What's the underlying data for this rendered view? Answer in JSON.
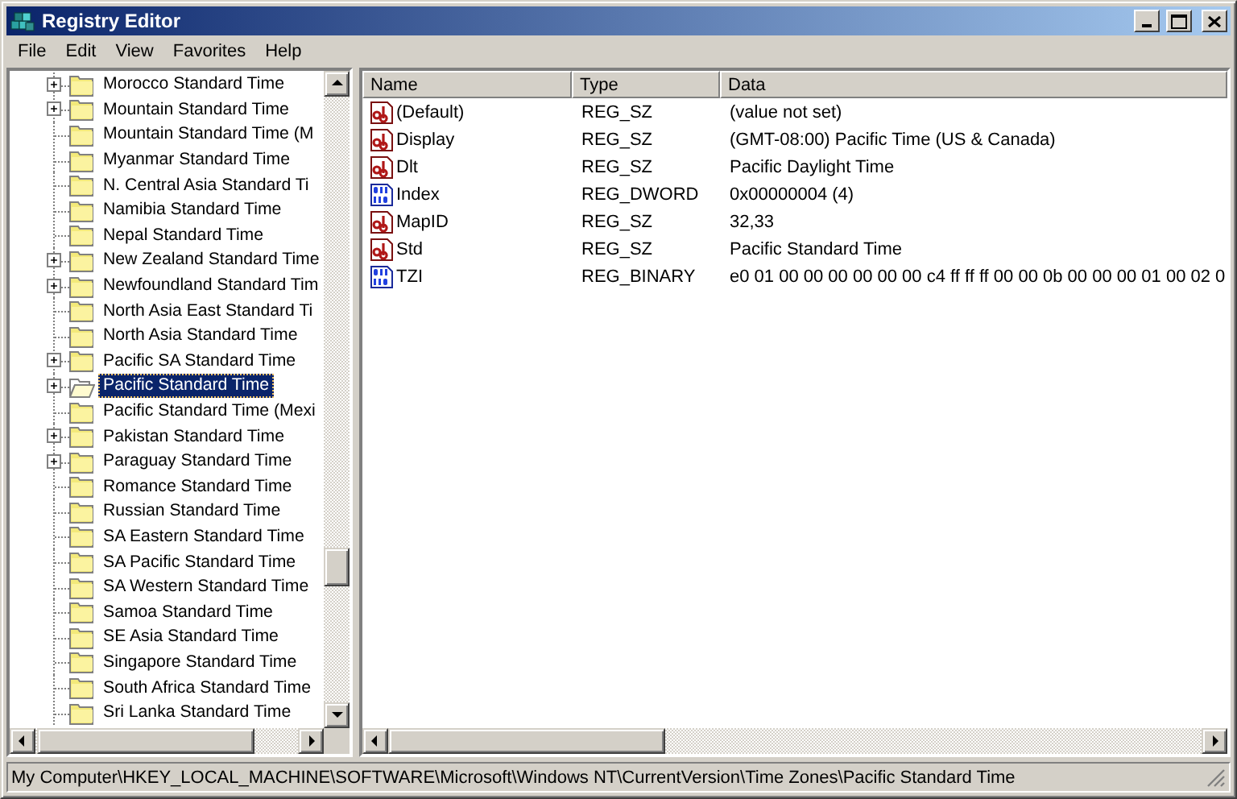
{
  "window": {
    "title": "Registry Editor"
  },
  "menu": [
    "File",
    "Edit",
    "View",
    "Favorites",
    "Help"
  ],
  "tree": {
    "items": [
      {
        "label": "Morocco Standard Time",
        "expandable": true,
        "selected": false
      },
      {
        "label": "Mountain Standard Time",
        "expandable": true,
        "selected": false
      },
      {
        "label": "Mountain Standard Time (M",
        "expandable": false,
        "selected": false
      },
      {
        "label": "Myanmar Standard Time",
        "expandable": false,
        "selected": false
      },
      {
        "label": "N. Central Asia Standard Ti",
        "expandable": false,
        "selected": false
      },
      {
        "label": "Namibia Standard Time",
        "expandable": false,
        "selected": false
      },
      {
        "label": "Nepal Standard Time",
        "expandable": false,
        "selected": false
      },
      {
        "label": "New Zealand Standard Time",
        "expandable": true,
        "selected": false
      },
      {
        "label": "Newfoundland Standard Tim",
        "expandable": true,
        "selected": false
      },
      {
        "label": "North Asia East Standard Ti",
        "expandable": false,
        "selected": false
      },
      {
        "label": "North Asia Standard Time",
        "expandable": false,
        "selected": false
      },
      {
        "label": "Pacific SA Standard Time",
        "expandable": true,
        "selected": false
      },
      {
        "label": "Pacific Standard Time",
        "expandable": true,
        "selected": true
      },
      {
        "label": "Pacific Standard Time (Mexi",
        "expandable": false,
        "selected": false
      },
      {
        "label": "Pakistan Standard Time",
        "expandable": true,
        "selected": false
      },
      {
        "label": "Paraguay Standard Time",
        "expandable": true,
        "selected": false
      },
      {
        "label": "Romance Standard Time",
        "expandable": false,
        "selected": false
      },
      {
        "label": "Russian Standard Time",
        "expandable": false,
        "selected": false
      },
      {
        "label": "SA Eastern Standard Time",
        "expandable": false,
        "selected": false
      },
      {
        "label": "SA Pacific Standard Time",
        "expandable": false,
        "selected": false
      },
      {
        "label": "SA Western Standard Time",
        "expandable": false,
        "selected": false
      },
      {
        "label": "Samoa Standard Time",
        "expandable": false,
        "selected": false
      },
      {
        "label": "SE Asia Standard Time",
        "expandable": false,
        "selected": false
      },
      {
        "label": "Singapore Standard Time",
        "expandable": false,
        "selected": false
      },
      {
        "label": "South Africa Standard Time",
        "expandable": false,
        "selected": false
      },
      {
        "label": "Sri Lanka Standard Time",
        "expandable": false,
        "selected": false
      }
    ]
  },
  "values": {
    "columns": [
      "Name",
      "Type",
      "Data"
    ],
    "rows": [
      {
        "kind": "string",
        "name": "(Default)",
        "type": "REG_SZ",
        "data": "(value not set)"
      },
      {
        "kind": "string",
        "name": "Display",
        "type": "REG_SZ",
        "data": "(GMT-08:00) Pacific Time (US & Canada)"
      },
      {
        "kind": "string",
        "name": "Dlt",
        "type": "REG_SZ",
        "data": "Pacific Daylight Time"
      },
      {
        "kind": "binary",
        "name": "Index",
        "type": "REG_DWORD",
        "data": "0x00000004 (4)"
      },
      {
        "kind": "string",
        "name": "MapID",
        "type": "REG_SZ",
        "data": "32,33"
      },
      {
        "kind": "string",
        "name": "Std",
        "type": "REG_SZ",
        "data": "Pacific Standard Time"
      },
      {
        "kind": "binary",
        "name": "TZI",
        "type": "REG_BINARY",
        "data": "e0 01 00 00 00 00 00 00 c4 ff ff ff 00 00 0b 00 00 00 01 00 02 0"
      }
    ]
  },
  "status_bar": "My Computer\\HKEY_LOCAL_MACHINE\\SOFTWARE\\Microsoft\\Windows NT\\CurrentVersion\\Time Zones\\Pacific Standard Time"
}
